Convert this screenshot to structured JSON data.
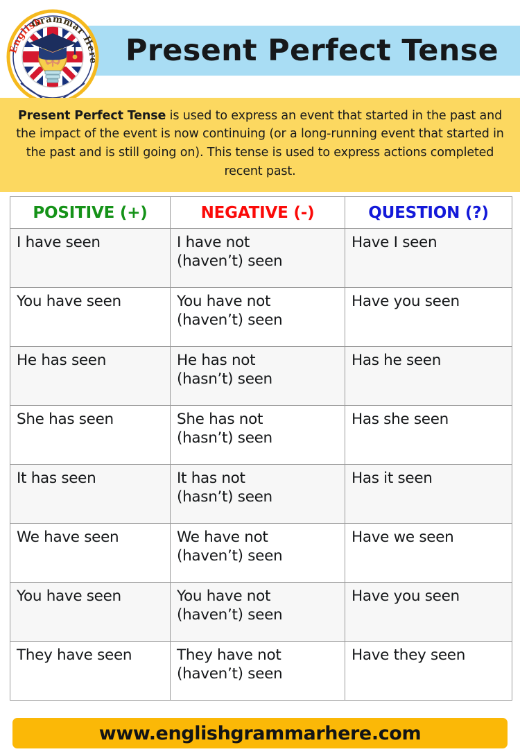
{
  "header": {
    "title": "Present Perfect Tense",
    "band_color": "#A9DDF4"
  },
  "logo": {
    "name": "english-grammar-here-logo",
    "text_left": "English",
    "text_right": "Grammar Here.Com",
    "border_color": "#F5B91E",
    "flag": "uk-flag",
    "symbols": [
      "graduation-cap",
      "lightbulb-brain"
    ]
  },
  "intro": {
    "bold_lead": "Present Perfect Tense",
    "body": " is used to express an event that started in the past and the impact of the event is now continuing (or a long-running event that started in the past and is still going on). This tense is used to express actions completed recent past.",
    "background_color": "#FCD860"
  },
  "table": {
    "headers": [
      {
        "label": "POSITIVE (+)",
        "color": "#159218"
      },
      {
        "label": "NEGATIVE (-)",
        "color": "#FB0A08"
      },
      {
        "label": "QUESTION (?)",
        "color": "#1319D9"
      }
    ],
    "rows": [
      {
        "positive": "I have seen",
        "negative_l1": "I have not",
        "negative_l2": "(haven’t) seen",
        "question": "Have I seen"
      },
      {
        "positive": "You have seen",
        "negative_l1": "You have not",
        "negative_l2": "(haven’t) seen",
        "question": "Have you seen"
      },
      {
        "positive": "He has seen",
        "negative_l1": "He has not",
        "negative_l2": "(hasn’t) seen",
        "question": "Has he seen"
      },
      {
        "positive": "She has seen",
        "negative_l1": "She has not",
        "negative_l2": "(hasn’t) seen",
        "question": "Has she seen"
      },
      {
        "positive": "It has seen",
        "negative_l1": "It has not",
        "negative_l2": "(hasn’t) seen",
        "question": "Has it seen"
      },
      {
        "positive": "We have seen",
        "negative_l1": "We have not",
        "negative_l2": "(haven’t) seen",
        "question": "Have we seen"
      },
      {
        "positive": "You have seen",
        "negative_l1": "You have not",
        "negative_l2": "(haven’t) seen",
        "question": "Have you seen"
      },
      {
        "positive": "They have seen",
        "negative_l1": "They have not",
        "negative_l2": "(haven’t) seen",
        "question": "Have they seen"
      }
    ]
  },
  "footer": {
    "url": "www.englishgrammarhere.com",
    "background_color": "#FBB807"
  }
}
